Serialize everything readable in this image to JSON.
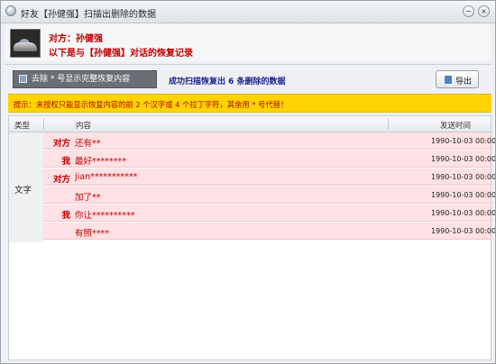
{
  "window": {
    "title": "好友【孙健强】扫描出删除的数据",
    "minimize_glyph": "−",
    "close_glyph": "×"
  },
  "header": {
    "line1": "对方：孙健强",
    "line2": "以下是与【孙健强】对话的恢复记录"
  },
  "toolbar": {
    "remove_label": "去除 * 号显示完整恢复内容",
    "scan_status": "成功扫描恢复出 6 条删除的数据",
    "export_label": "导出"
  },
  "notice": {
    "text": "提示：未授权只能显示恢复内容的前 2 个汉字或 4 个拉丁字符，其余用 * 号代替！"
  },
  "table": {
    "columns": {
      "type": "类型",
      "content": "内容",
      "time": "发送时间"
    },
    "group_type": "文字",
    "rows": [
      {
        "sender": "对方",
        "content": "还有**",
        "time": "1990-10-03 00:00"
      },
      {
        "sender": "我",
        "content": "最好********",
        "time": "1990-10-03 00:00"
      },
      {
        "sender": "对方",
        "content": "jian***********",
        "time": "1990-10-03 00:00"
      },
      {
        "sender": "",
        "content": "加了**",
        "time": "1990-10-03 00:00"
      },
      {
        "sender": "我",
        "content": "你让**********",
        "time": "1990-10-03 00:00"
      },
      {
        "sender": "",
        "content": "有照****",
        "time": "1990-10-03 00:00"
      }
    ]
  }
}
